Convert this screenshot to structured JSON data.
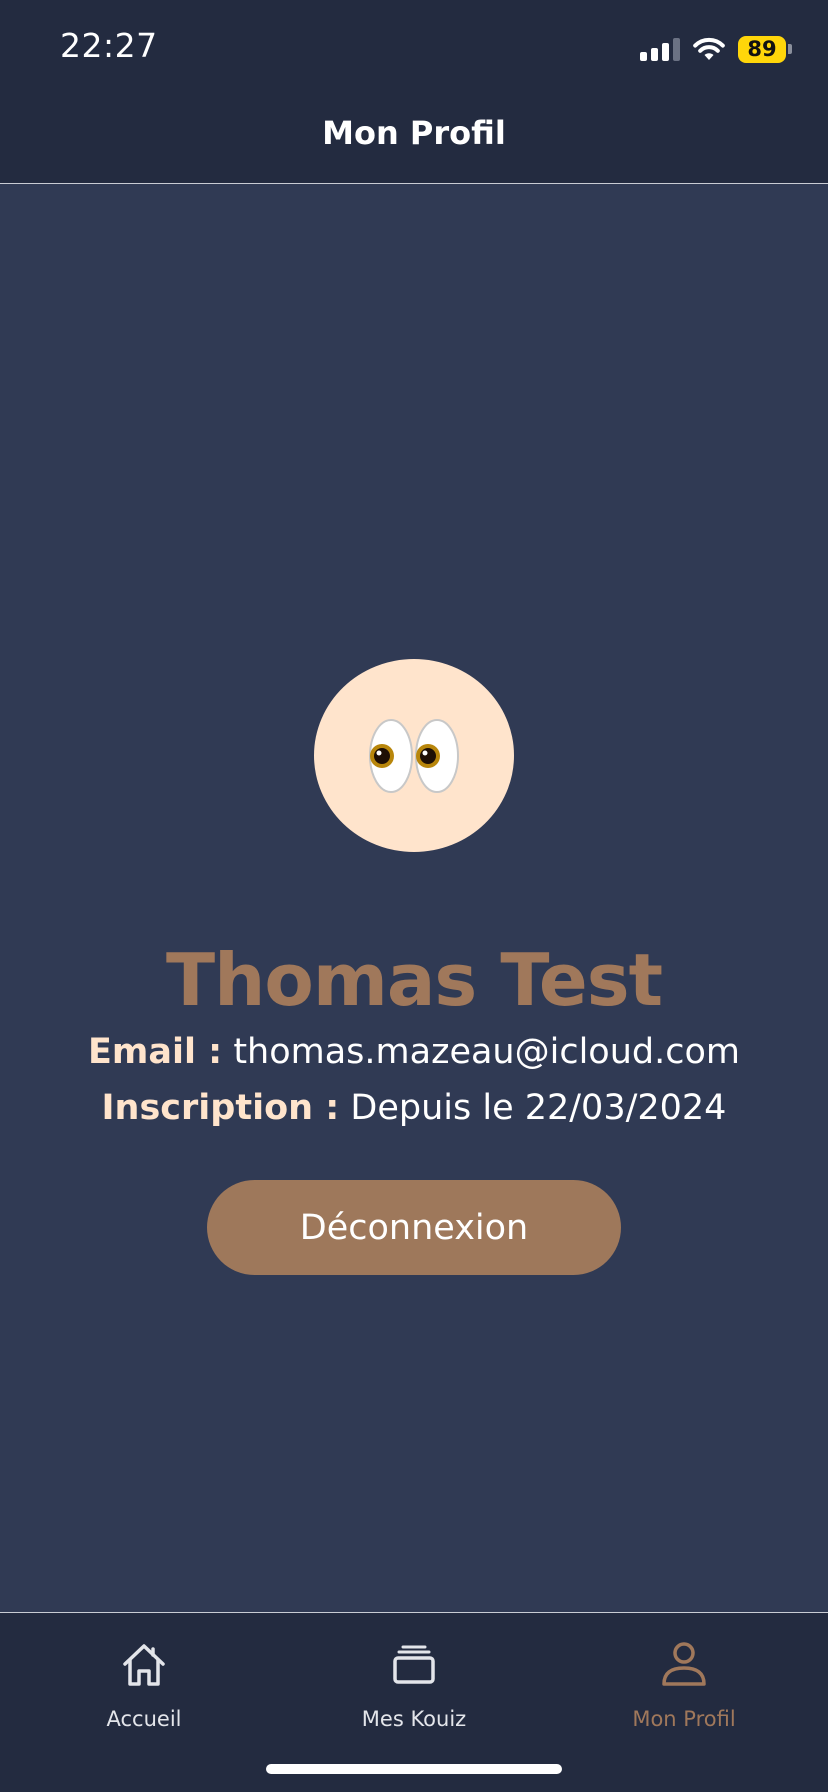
{
  "status_bar": {
    "time": "22:27",
    "battery_level": "89",
    "icons": [
      "cellular-signal-icon",
      "wifi-icon",
      "battery-icon"
    ]
  },
  "header": {
    "title": "Mon Profil"
  },
  "profile": {
    "avatar_emoji": "👀",
    "name": "Thomas Test",
    "email_label": "Email :",
    "email_value": "thomas.mazeau@icloud.com",
    "since_label": "Inscription :",
    "since_value": "Depuis le 22/03/2024",
    "logout_label": "Déconnexion"
  },
  "tabbar": {
    "tabs": [
      {
        "label": "Accueil",
        "icon": "home-icon",
        "active": false
      },
      {
        "label": "Mes Kouiz",
        "icon": "cards-stack-icon",
        "active": false
      },
      {
        "label": "Mon Profil",
        "icon": "person-icon",
        "active": true
      }
    ]
  },
  "colors": {
    "background": "#303a54",
    "bar_background": "#232b40",
    "accent": "#a0785b",
    "avatar_background": "#ffe4cc",
    "label": "#ffe4cc",
    "battery": "#ffd60a"
  }
}
